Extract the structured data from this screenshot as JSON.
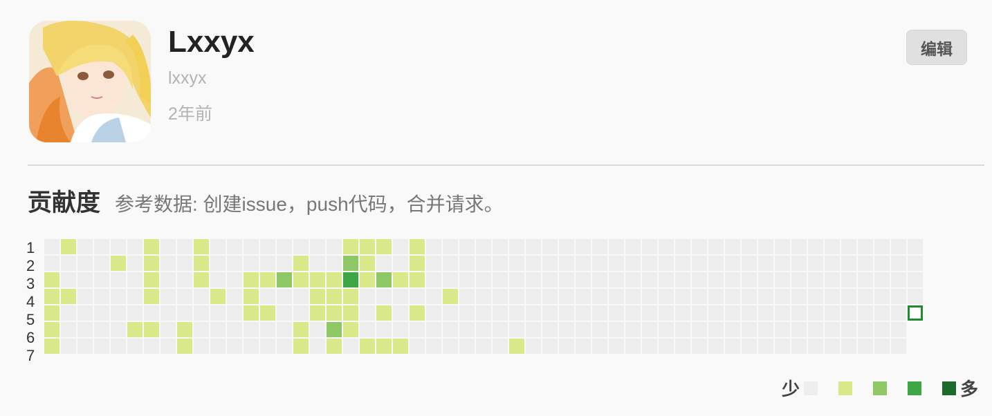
{
  "profile": {
    "display_name": "Lxxyx",
    "username": "lxxyx",
    "joined": "2年前",
    "edit_label": "编辑",
    "avatar_description": "anime-avatar"
  },
  "contributions": {
    "title": "贡献度",
    "description": "参考数据: 创建issue，push代码，合并请求。",
    "weekday_labels": [
      "1",
      "2",
      "3",
      "4",
      "5",
      "6",
      "7"
    ],
    "weeks": 53,
    "colors": [
      "#ededed",
      "#d9e98a",
      "#8ec865",
      "#3ea745",
      "#1c6b2c"
    ],
    "empty_color": "#ededed",
    "today_outline_color": "#1e8c2e",
    "legend": {
      "less": "少",
      "more": "多"
    },
    "active_days": [
      [
        1,
        0,
        1
      ],
      [
        6,
        0,
        1
      ],
      [
        9,
        0,
        1
      ],
      [
        18,
        0,
        1
      ],
      [
        19,
        0,
        1
      ],
      [
        20,
        0,
        1
      ],
      [
        22,
        0,
        1
      ],
      [
        4,
        1,
        1
      ],
      [
        6,
        1,
        1
      ],
      [
        9,
        1,
        1
      ],
      [
        15,
        1,
        1
      ],
      [
        18,
        1,
        2
      ],
      [
        19,
        1,
        1
      ],
      [
        22,
        1,
        1
      ],
      [
        0,
        2,
        1
      ],
      [
        6,
        2,
        1
      ],
      [
        9,
        2,
        1
      ],
      [
        12,
        2,
        1
      ],
      [
        13,
        2,
        1
      ],
      [
        14,
        2,
        2
      ],
      [
        15,
        2,
        1
      ],
      [
        16,
        2,
        1
      ],
      [
        17,
        2,
        1
      ],
      [
        18,
        2,
        3
      ],
      [
        19,
        2,
        1
      ],
      [
        20,
        2,
        2
      ],
      [
        21,
        2,
        1
      ],
      [
        22,
        2,
        1
      ],
      [
        0,
        3,
        1
      ],
      [
        1,
        3,
        1
      ],
      [
        6,
        3,
        1
      ],
      [
        10,
        3,
        1
      ],
      [
        12,
        3,
        1
      ],
      [
        16,
        3,
        1
      ],
      [
        17,
        3,
        1
      ],
      [
        18,
        3,
        1
      ],
      [
        24,
        3,
        1
      ],
      [
        0,
        4,
        1
      ],
      [
        12,
        4,
        1
      ],
      [
        13,
        4,
        1
      ],
      [
        16,
        4,
        1
      ],
      [
        17,
        4,
        1
      ],
      [
        18,
        4,
        1
      ],
      [
        20,
        4,
        1
      ],
      [
        22,
        4,
        1
      ],
      [
        0,
        5,
        1
      ],
      [
        5,
        5,
        1
      ],
      [
        6,
        5,
        1
      ],
      [
        8,
        5,
        1
      ],
      [
        15,
        5,
        1
      ],
      [
        17,
        5,
        2
      ],
      [
        18,
        5,
        1
      ],
      [
        0,
        6,
        1
      ],
      [
        8,
        6,
        1
      ],
      [
        15,
        6,
        1
      ],
      [
        17,
        6,
        1
      ],
      [
        19,
        6,
        1
      ],
      [
        20,
        6,
        1
      ],
      [
        21,
        6,
        1
      ],
      [
        28,
        6,
        1
      ]
    ],
    "today": {
      "week": 52,
      "day": 4
    },
    "last_week_days": 5
  }
}
